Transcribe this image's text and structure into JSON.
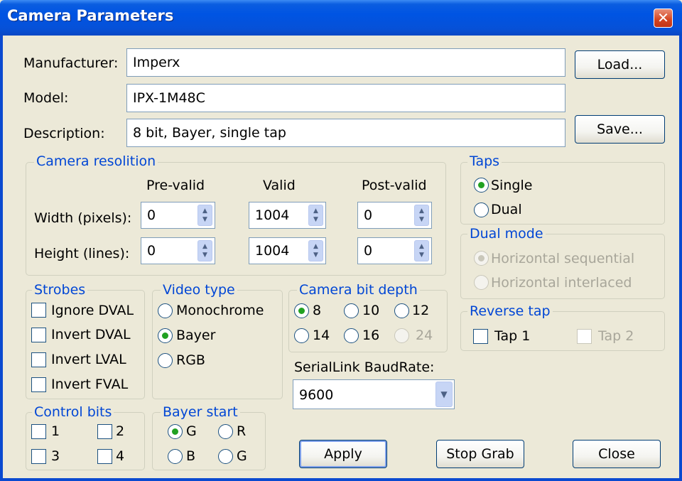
{
  "window": {
    "title": "Camera Parameters",
    "close_icon": "close-icon"
  },
  "fields": {
    "manufacturer": {
      "label": "Manufacturer:",
      "value": "Imperx"
    },
    "model": {
      "label": "Model:",
      "value": "IPX-1M48C"
    },
    "description": {
      "label": "Description:",
      "value": "8 bit, Bayer, single tap"
    }
  },
  "buttons": {
    "load": "Load...",
    "save": "Save...",
    "apply": "Apply",
    "stop_grab": "Stop Grab",
    "close": "Close"
  },
  "resolution": {
    "title": "Camera resolition",
    "columns": [
      "Pre-valid",
      "Valid",
      "Post-valid"
    ],
    "rows": [
      {
        "label": "Width (pixels):",
        "values": [
          "0",
          "1004",
          "0"
        ]
      },
      {
        "label": "Height (lines):",
        "values": [
          "0",
          "1004",
          "0"
        ]
      }
    ]
  },
  "taps": {
    "title": "Taps",
    "options": [
      "Single",
      "Dual"
    ],
    "selected": "Single"
  },
  "dual_mode": {
    "title": "Dual mode",
    "options": [
      "Horizontal sequential",
      "Horizontal interlaced"
    ],
    "enabled": false
  },
  "reverse_tap": {
    "title": "Reverse tap",
    "options": [
      "Tap 1",
      "Tap 2"
    ]
  },
  "strobes": {
    "title": "Strobes",
    "options": [
      "Ignore DVAL",
      "Invert DVAL",
      "Invert LVAL",
      "Invert FVAL"
    ]
  },
  "video_type": {
    "title": "Video type",
    "options": [
      "Monochrome",
      "Bayer",
      "RGB"
    ],
    "selected": "Bayer"
  },
  "bit_depth": {
    "title": "Camera bit depth",
    "options": [
      "8",
      "10",
      "12",
      "14",
      "16",
      "24"
    ],
    "selected": "8"
  },
  "serial": {
    "label": "SerialLink BaudRate:",
    "value": "9600"
  },
  "control_bits": {
    "title": "Control bits",
    "options": [
      "1",
      "2",
      "3",
      "4"
    ]
  },
  "bayer_start": {
    "title": "Bayer start",
    "options": [
      "G",
      "R",
      "B",
      "G"
    ],
    "selected": "G"
  },
  "colors": {
    "titlebar": "#0054e3",
    "background": "#ece9d8",
    "legend": "#0046d5",
    "radio_dot": "#21a121",
    "close_button": "#d4431f"
  }
}
